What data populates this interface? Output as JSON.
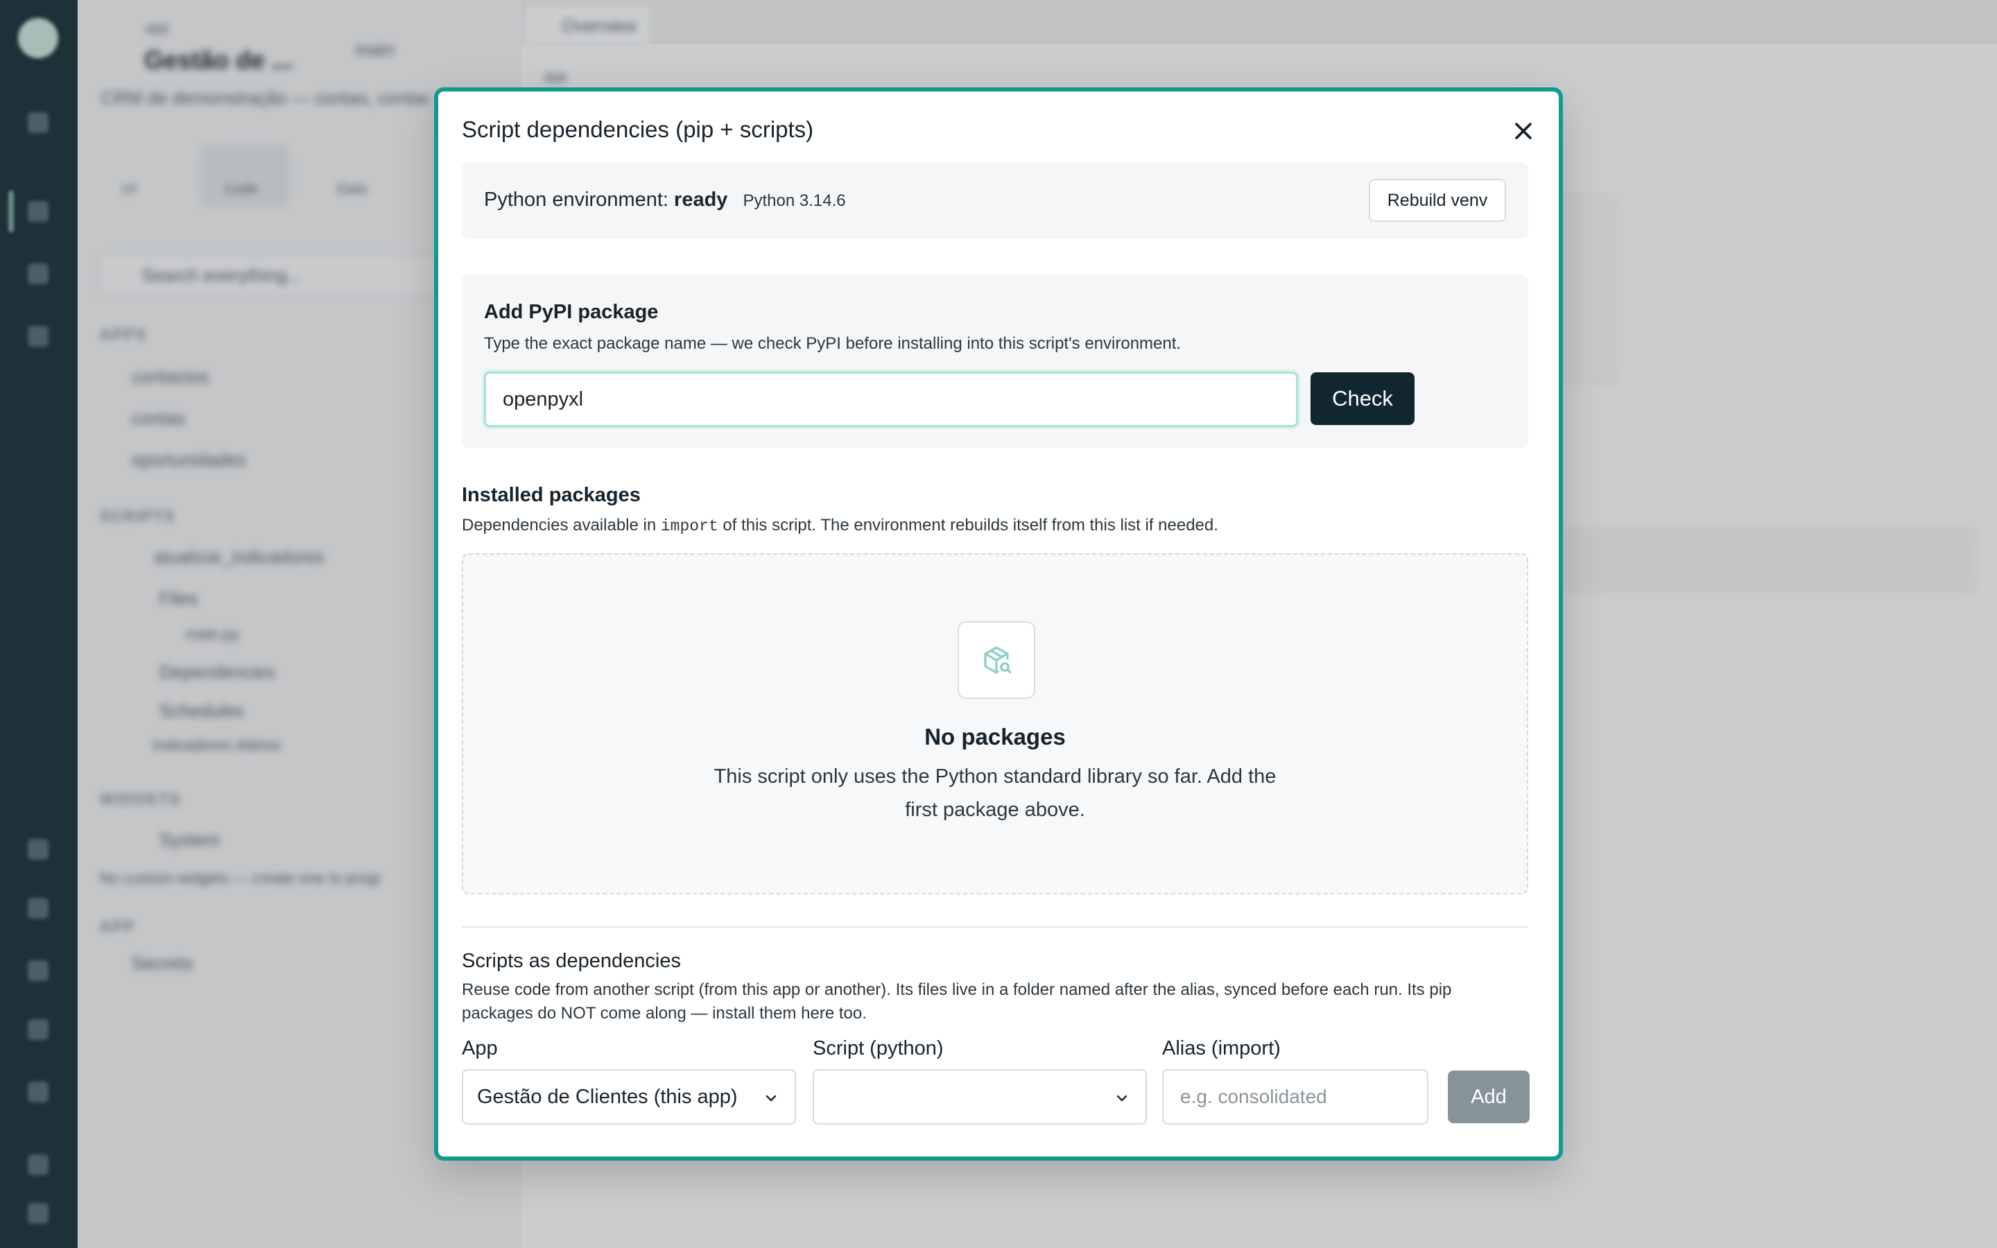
{
  "background": {
    "repo_label": "app",
    "app_title": "Gestão de ...",
    "branch": "main",
    "app_desc": "CRM de demonstração — contas, contac",
    "mode_tiles": [
      "UI",
      "Code",
      "Data"
    ],
    "search_placeholder": "Search everything...",
    "apps_section": "APPS",
    "apps": [
      "contactos",
      "contas",
      "oportunidades"
    ],
    "scripts_section": "SCRIPTS",
    "script_name": "atualizar_indicadores",
    "files_label": "Files",
    "file_name": "main.py",
    "deps_label": "Dependencies",
    "schedules_label": "Schedules",
    "schedule_item": "Indicadores diários",
    "widgets_section": "WIDGETS",
    "system_label": "System",
    "widgets_note": "No custom widgets — create one to progr",
    "app_section": "APP",
    "secrets_label": "Secrets",
    "tab_label": "Overview",
    "main_label": "app"
  },
  "modal": {
    "title": "Script dependencies (pip + scripts)",
    "environment": {
      "label": "Python environment:",
      "status": "ready",
      "version": "Python 3.14.6",
      "rebuild_label": "Rebuild venv"
    },
    "pypi": {
      "title": "Add PyPI package",
      "description": "Type the exact package name — we check PyPI before installing into this script's environment.",
      "input_value": "openpyxl",
      "check_label": "Check"
    },
    "installed": {
      "title": "Installed packages",
      "desc_before": "Dependencies available in",
      "desc_code": "import",
      "desc_after": "of this script. The environment rebuilds itself from this list if needed.",
      "empty_title": "No packages",
      "empty_line1": "This script only uses the Python standard library so far. Add the",
      "empty_line2": "first package above."
    },
    "script_deps": {
      "title": "Scripts as dependencies",
      "desc_line1": "Reuse code from another script (from this app or another). Its files live in a folder named after the alias, synced before each run. Its pip",
      "desc_line2": "packages do NOT come along — install them here too.",
      "app_label": "App",
      "app_value": "Gestão de Clientes (this app)",
      "script_label": "Script (python)",
      "script_value": "",
      "alias_label": "Alias (import)",
      "alias_placeholder": "e.g. consolidated",
      "add_label": "Add"
    }
  },
  "colors": {
    "accent": "#0f9b8e",
    "dark_button": "#122630",
    "disabled_button": "#87939a",
    "rail": "#1e3038"
  }
}
